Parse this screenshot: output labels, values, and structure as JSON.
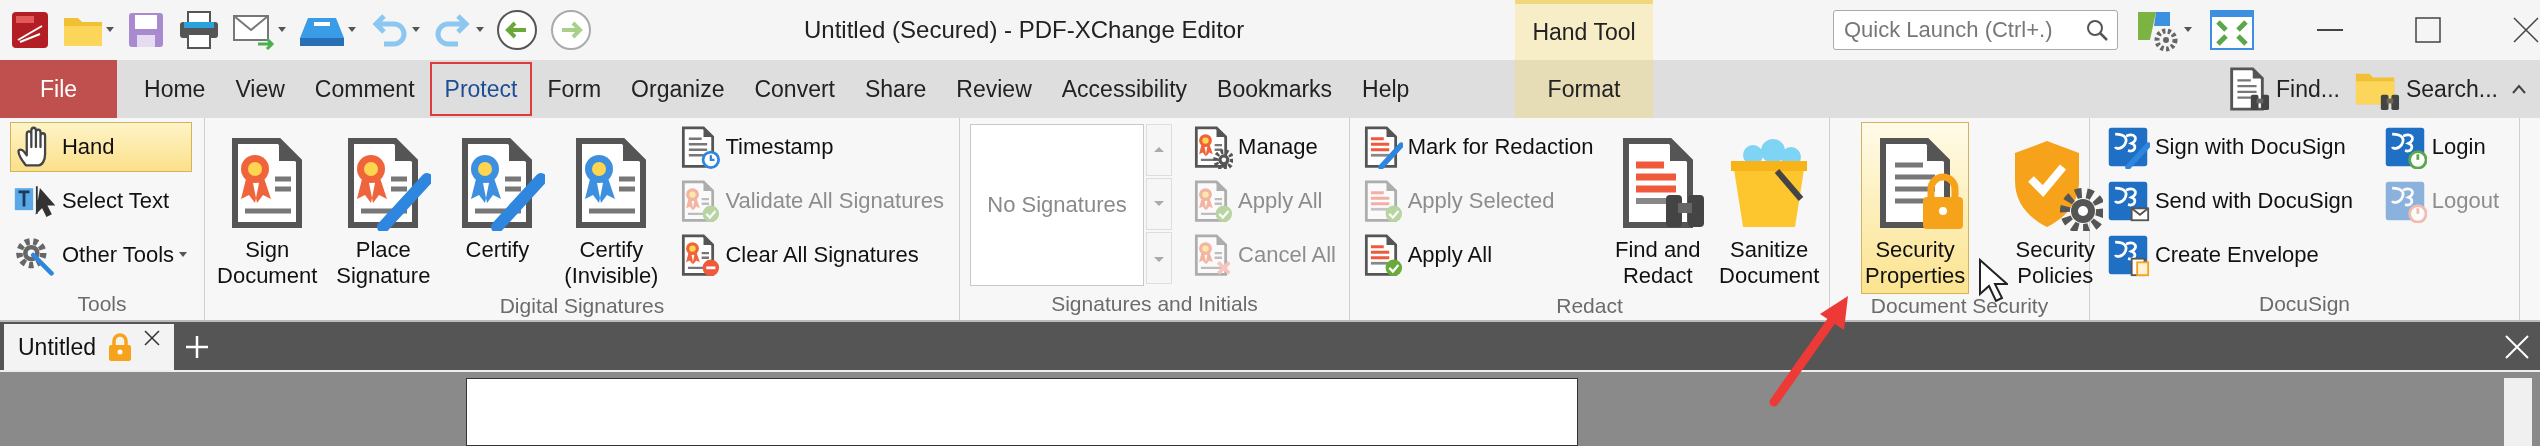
{
  "title_bar": {
    "title": "Untitled (Secured) - PDF-XChange Editor",
    "context_tab_group": "Hand Tool",
    "quick_launch": {
      "placeholder": "Quick Launch (Ctrl+.)"
    }
  },
  "menu_tabs": [
    {
      "label": "File",
      "kind": "file",
      "selected": false
    },
    {
      "label": "Home",
      "kind": "tab",
      "selected": false
    },
    {
      "label": "View",
      "kind": "tab",
      "selected": false
    },
    {
      "label": "Comment",
      "kind": "tab",
      "selected": false
    },
    {
      "label": "Protect",
      "kind": "tab",
      "selected": true
    },
    {
      "label": "Form",
      "kind": "tab",
      "selected": false
    },
    {
      "label": "Organize",
      "kind": "tab",
      "selected": false
    },
    {
      "label": "Convert",
      "kind": "tab",
      "selected": false
    },
    {
      "label": "Share",
      "kind": "tab",
      "selected": false
    },
    {
      "label": "Review",
      "kind": "tab",
      "selected": false
    },
    {
      "label": "Accessibility",
      "kind": "tab",
      "selected": false
    },
    {
      "label": "Bookmarks",
      "kind": "tab",
      "selected": false
    },
    {
      "label": "Help",
      "kind": "tab",
      "selected": false
    },
    {
      "label": "Format",
      "kind": "context",
      "selected": false
    }
  ],
  "ribbon_commands": [
    {
      "label": "Find..."
    },
    {
      "label": "Search..."
    }
  ],
  "ribbon_groups": [
    {
      "name": "Tools",
      "items": [
        {
          "kind": "stack",
          "buttons": [
            {
              "label": "Hand",
              "highlighted": true,
              "disabled": false
            },
            {
              "label": "Select Text",
              "highlighted": false,
              "disabled": false
            },
            {
              "label": "Other Tools",
              "highlighted": false,
              "disabled": false
            }
          ]
        }
      ]
    },
    {
      "name": "Digital Signatures",
      "items": [
        {
          "kind": "large",
          "label": "Sign\nDocument",
          "highlighted": false,
          "disabled": false
        },
        {
          "kind": "large",
          "label": "Place\nSignature",
          "highlighted": false,
          "disabled": false
        },
        {
          "kind": "large",
          "label": "Certify",
          "highlighted": false,
          "disabled": false
        },
        {
          "kind": "large",
          "label": "Certify\n(Invisible)",
          "highlighted": false,
          "disabled": false
        },
        {
          "kind": "stack",
          "buttons": [
            {
              "label": "Timestamp",
              "highlighted": false,
              "disabled": false
            },
            {
              "label": "Validate All Signatures",
              "highlighted": false,
              "disabled": true
            },
            {
              "label": "Clear All Signatures",
              "highlighted": false,
              "disabled": false
            }
          ]
        }
      ]
    },
    {
      "name": "Signatures and Initials",
      "items": [
        {
          "kind": "list",
          "text": "No Signatures"
        },
        {
          "kind": "stack",
          "buttons": [
            {
              "label": "Manage",
              "highlighted": false,
              "disabled": false
            },
            {
              "label": "Apply All",
              "highlighted": false,
              "disabled": true
            },
            {
              "label": "Cancel All",
              "highlighted": false,
              "disabled": true
            }
          ]
        }
      ]
    },
    {
      "name": "Redact",
      "items": [
        {
          "kind": "stack",
          "buttons": [
            {
              "label": "Mark for Redaction",
              "highlighted": false,
              "disabled": false
            },
            {
              "label": "Apply Selected",
              "highlighted": false,
              "disabled": true
            },
            {
              "label": "Apply All",
              "highlighted": false,
              "disabled": false
            }
          ]
        },
        {
          "kind": "large",
          "label": "Find and\nRedact",
          "highlighted": false,
          "disabled": false
        },
        {
          "kind": "large",
          "label": "Sanitize\nDocument",
          "highlighted": false,
          "disabled": false
        }
      ]
    },
    {
      "name": "Document Security",
      "items": [
        {
          "kind": "large",
          "label": "Security\nProperties",
          "highlighted": true,
          "disabled": false
        },
        {
          "kind": "large",
          "label": "Security\nPolicies",
          "highlighted": false,
          "disabled": false
        }
      ]
    },
    {
      "name": "DocuSign",
      "items": [
        {
          "kind": "stack",
          "buttons": [
            {
              "label": "Sign with DocuSign",
              "highlighted": false,
              "disabled": false
            },
            {
              "label": "Send with DocuSign",
              "highlighted": false,
              "disabled": false
            },
            {
              "label": "Create Envelope",
              "highlighted": false,
              "disabled": false
            }
          ]
        },
        {
          "kind": "stack",
          "buttons": [
            {
              "label": "Login",
              "highlighted": false,
              "disabled": false
            },
            {
              "label": "Logout",
              "highlighted": false,
              "disabled": true
            }
          ]
        }
      ]
    }
  ],
  "document_tabs": [
    {
      "label": "Untitled",
      "selected": true
    }
  ]
}
